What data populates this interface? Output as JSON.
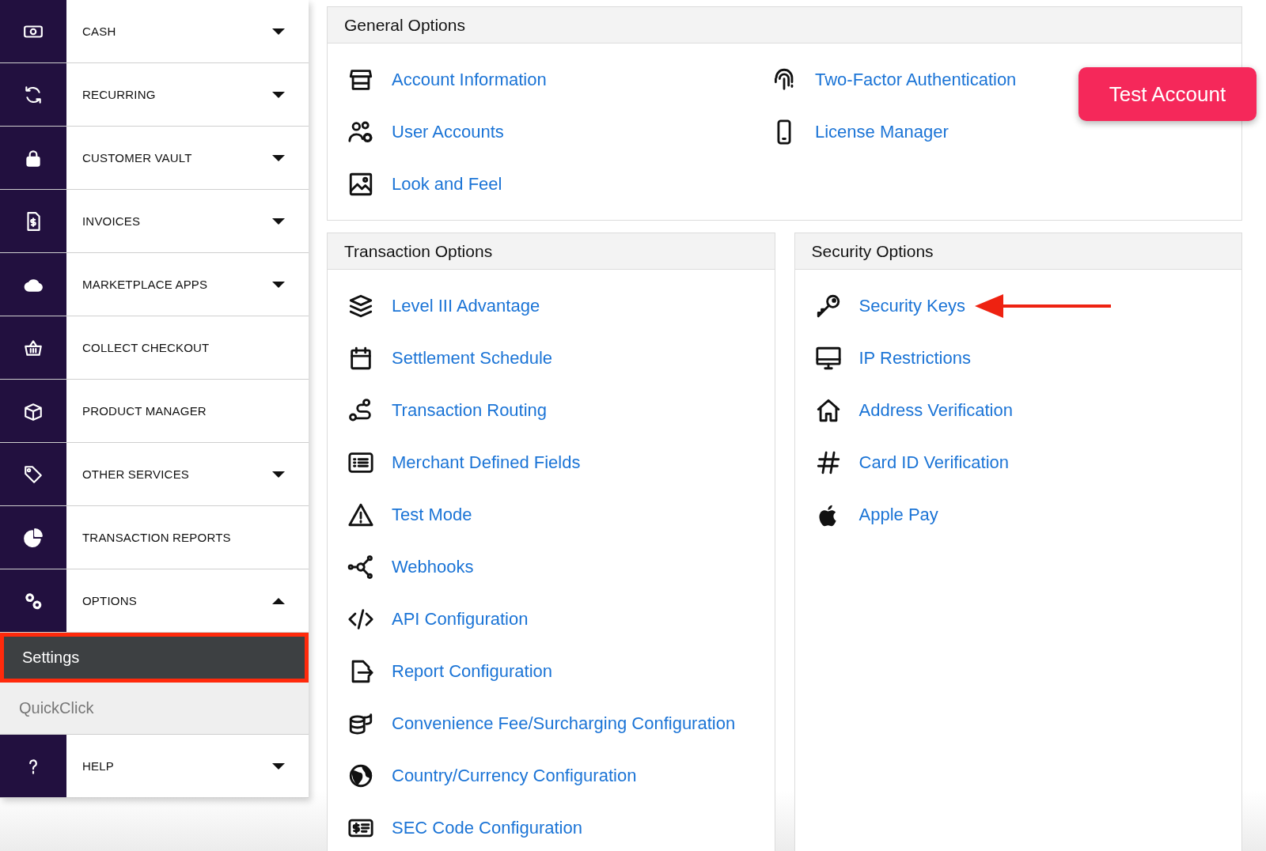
{
  "sidebar": {
    "items": [
      {
        "label": "CASH",
        "kind": "group",
        "expanded": false
      },
      {
        "label": "RECURRING",
        "kind": "group",
        "expanded": false
      },
      {
        "label": "CUSTOMER VAULT",
        "kind": "group",
        "expanded": false
      },
      {
        "label": "INVOICES",
        "kind": "group",
        "expanded": false
      },
      {
        "label": "MARKETPLACE APPS",
        "kind": "group",
        "expanded": false
      },
      {
        "label": "COLLECT CHECKOUT",
        "kind": "link"
      },
      {
        "label": "PRODUCT MANAGER",
        "kind": "link"
      },
      {
        "label": "OTHER SERVICES",
        "kind": "group",
        "expanded": false
      },
      {
        "label": "TRANSACTION REPORTS",
        "kind": "link"
      },
      {
        "label": "OPTIONS",
        "kind": "group",
        "expanded": true,
        "children": [
          {
            "label": "Settings",
            "selected": true,
            "highlighted": true
          },
          {
            "label": "QuickClick",
            "selected": false,
            "highlighted": false
          }
        ]
      },
      {
        "label": "HELP",
        "kind": "group",
        "expanded": false
      }
    ]
  },
  "general_options": {
    "title": "General Options",
    "items": [
      {
        "label": "Account Information"
      },
      {
        "label": "Two-Factor Authentication"
      },
      {
        "label": "User Accounts"
      },
      {
        "label": "License Manager"
      },
      {
        "label": "Look and Feel"
      }
    ]
  },
  "test_account_button": "Test Account",
  "transaction_options": {
    "title": "Transaction Options",
    "items": [
      {
        "label": "Level III Advantage"
      },
      {
        "label": "Settlement Schedule"
      },
      {
        "label": "Transaction Routing"
      },
      {
        "label": "Merchant Defined Fields"
      },
      {
        "label": "Test Mode"
      },
      {
        "label": "Webhooks"
      },
      {
        "label": "API Configuration"
      },
      {
        "label": "Report Configuration"
      },
      {
        "label": "Convenience Fee/Surcharging Configuration"
      },
      {
        "label": "Country/Currency Configuration"
      },
      {
        "label": "SEC Code Configuration"
      }
    ]
  },
  "security_options": {
    "title": "Security Options",
    "items": [
      {
        "label": "Security Keys",
        "pointed_at": true
      },
      {
        "label": "IP Restrictions",
        "pointed_at": false
      },
      {
        "label": "Address Verification",
        "pointed_at": false
      },
      {
        "label": "Card ID Verification",
        "pointed_at": false
      },
      {
        "label": "Apple Pay",
        "pointed_at": false
      }
    ]
  }
}
